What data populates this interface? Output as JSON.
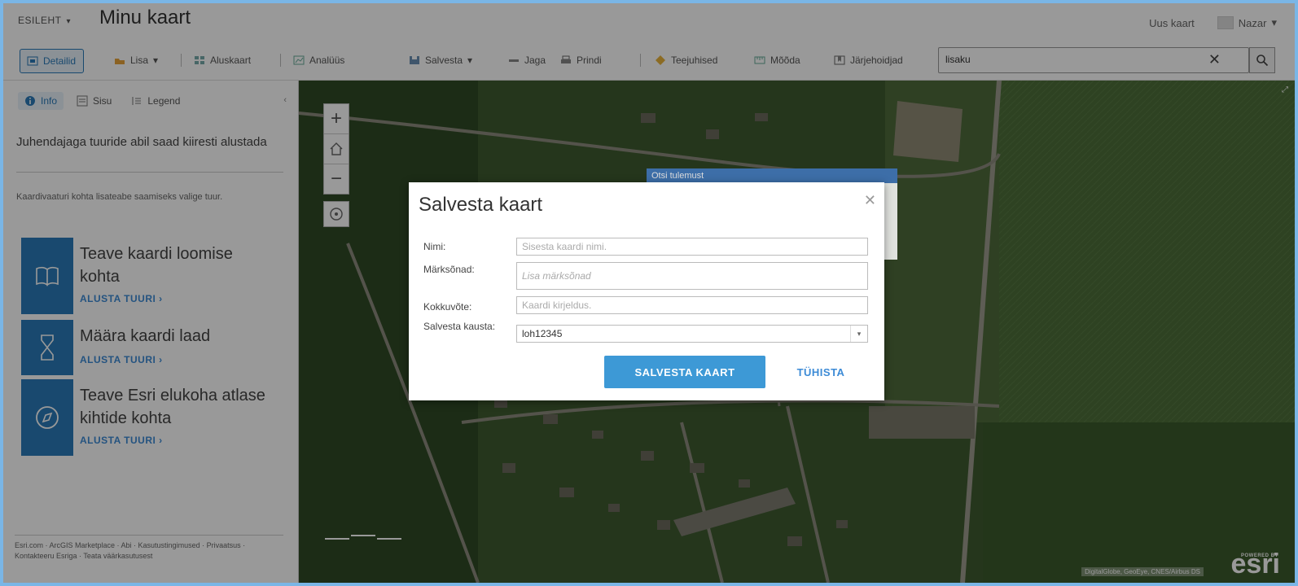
{
  "header": {
    "breadcrumb": "ESILEHT",
    "title": "Minu kaart",
    "new_map": "Uus kaart",
    "user": "Nazar"
  },
  "toolbar": {
    "details": "Detailid",
    "add": "Lisa",
    "basemap": "Aluskaart",
    "analysis": "Analüüs",
    "save": "Salvesta",
    "share": "Jaga",
    "print": "Prindi",
    "directions": "Teejuhised",
    "measure": "Mõõda",
    "bookmarks": "Järjehoidjad",
    "search_value": "lisaku"
  },
  "sidebar": {
    "tabs": [
      "Info",
      "Sisu",
      "Legend"
    ],
    "intro": "Juhendajaga tuuride abil saad kiiresti alustada",
    "hint": "Kaardivaaturi kohta lisateabe saamiseks valige tuur.",
    "tours": [
      {
        "title": "Teave kaardi loomise kohta",
        "action": "ALUSTA TUURI ›"
      },
      {
        "title": "Määra kaardi laad",
        "action": "ALUSTA TUURI ›"
      },
      {
        "title": "Teave Esri elukoha atlase kihtide kohta",
        "action": "ALUSTA TUURI ›"
      }
    ],
    "footer": "Esri.com · ArcGIS Marketplace · Abi · Kasutustingimused · Privaatsus · Kontakteeru Esriga · Teata väärkasutusest"
  },
  "map": {
    "attribution": "DigitalGlobe, GeoEye, CNES/Airbus DS",
    "logo": "esri",
    "logo_small": "POWERED BY",
    "popup_title": "Otsi tulemust"
  },
  "dialog": {
    "title": "Salvesta kaart",
    "name_label": "Nimi:",
    "name_placeholder": "Sisesta kaardi nimi.",
    "tags_label": "Märksõnad:",
    "tags_placeholder": "Lisa märksõnad",
    "summary_label": "Kokkuvõte:",
    "summary_placeholder": "Kaardi kirjeldus.",
    "folder_label": "Salvesta kausta:",
    "folder_value": "loh12345",
    "save_button": "SALVESTA KAART",
    "cancel_button": "TÜHISTA"
  }
}
